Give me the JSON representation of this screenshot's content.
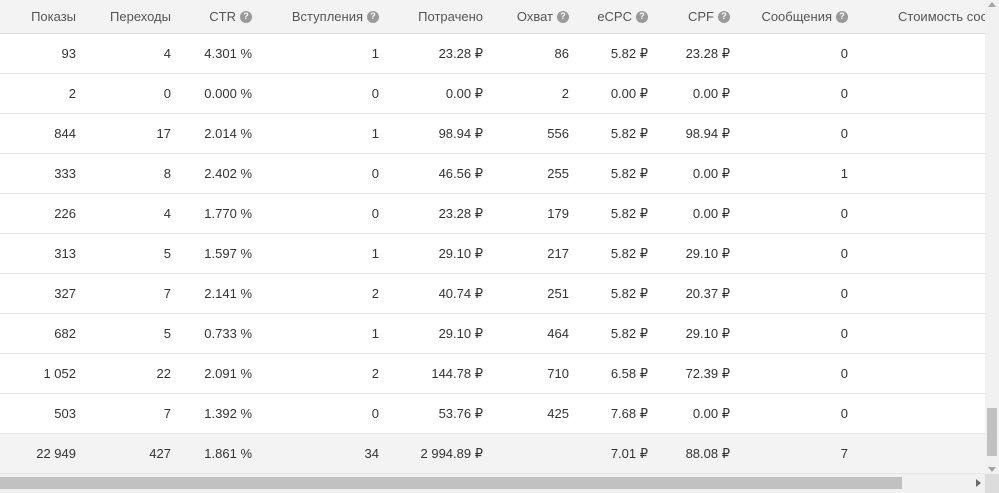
{
  "columns": [
    {
      "key": "impressions",
      "label": "Показы",
      "help": false
    },
    {
      "key": "clicks",
      "label": "Переходы",
      "help": false
    },
    {
      "key": "ctr",
      "label": "CTR",
      "help": true
    },
    {
      "key": "joins",
      "label": "Вступления",
      "help": true
    },
    {
      "key": "spent",
      "label": "Потрачено",
      "help": false
    },
    {
      "key": "reach",
      "label": "Охват",
      "help": true
    },
    {
      "key": "ecpc",
      "label": "eCPC",
      "help": true
    },
    {
      "key": "cpf",
      "label": "CPF",
      "help": true
    },
    {
      "key": "messages",
      "label": "Сообщения",
      "help": true
    },
    {
      "key": "message_cost",
      "label": "Стоимость соо",
      "help": false
    }
  ],
  "help_glyph": "?",
  "rows": [
    {
      "impressions": "93",
      "clicks": "4",
      "ctr": "4.301 %",
      "joins": "1",
      "spent": "23.28 ₽",
      "reach": "86",
      "ecpc": "5.82 ₽",
      "cpf": "23.28 ₽",
      "messages": "0",
      "message_cost": ""
    },
    {
      "impressions": "2",
      "clicks": "0",
      "ctr": "0.000 %",
      "joins": "0",
      "spent": "0.00 ₽",
      "reach": "2",
      "ecpc": "0.00 ₽",
      "cpf": "0.00 ₽",
      "messages": "0",
      "message_cost": ""
    },
    {
      "impressions": "844",
      "clicks": "17",
      "ctr": "2.014 %",
      "joins": "1",
      "spent": "98.94 ₽",
      "reach": "556",
      "ecpc": "5.82 ₽",
      "cpf": "98.94 ₽",
      "messages": "0",
      "message_cost": ""
    },
    {
      "impressions": "333",
      "clicks": "8",
      "ctr": "2.402 %",
      "joins": "0",
      "spent": "46.56 ₽",
      "reach": "255",
      "ecpc": "5.82 ₽",
      "cpf": "0.00 ₽",
      "messages": "1",
      "message_cost": ""
    },
    {
      "impressions": "226",
      "clicks": "4",
      "ctr": "1.770 %",
      "joins": "0",
      "spent": "23.28 ₽",
      "reach": "179",
      "ecpc": "5.82 ₽",
      "cpf": "0.00 ₽",
      "messages": "0",
      "message_cost": ""
    },
    {
      "impressions": "313",
      "clicks": "5",
      "ctr": "1.597 %",
      "joins": "1",
      "spent": "29.10 ₽",
      "reach": "217",
      "ecpc": "5.82 ₽",
      "cpf": "29.10 ₽",
      "messages": "0",
      "message_cost": ""
    },
    {
      "impressions": "327",
      "clicks": "7",
      "ctr": "2.141 %",
      "joins": "2",
      "spent": "40.74 ₽",
      "reach": "251",
      "ecpc": "5.82 ₽",
      "cpf": "20.37 ₽",
      "messages": "0",
      "message_cost": ""
    },
    {
      "impressions": "682",
      "clicks": "5",
      "ctr": "0.733 %",
      "joins": "1",
      "spent": "29.10 ₽",
      "reach": "464",
      "ecpc": "5.82 ₽",
      "cpf": "29.10 ₽",
      "messages": "0",
      "message_cost": ""
    },
    {
      "impressions": "1 052",
      "clicks": "22",
      "ctr": "2.091 %",
      "joins": "2",
      "spent": "144.78 ₽",
      "reach": "710",
      "ecpc": "6.58 ₽",
      "cpf": "72.39 ₽",
      "messages": "0",
      "message_cost": ""
    },
    {
      "impressions": "503",
      "clicks": "7",
      "ctr": "1.392 %",
      "joins": "0",
      "spent": "53.76 ₽",
      "reach": "425",
      "ecpc": "7.68 ₽",
      "cpf": "0.00 ₽",
      "messages": "0",
      "message_cost": ""
    }
  ],
  "totals": {
    "impressions": "22 949",
    "clicks": "427",
    "ctr": "1.861 %",
    "joins": "34",
    "spent": "2 994.89 ₽",
    "reach": "",
    "ecpc": "7.01 ₽",
    "cpf": "88.08 ₽",
    "messages": "7",
    "message_cost": ""
  },
  "colors": {
    "header_bg": "#f3f3f3",
    "row_border": "#e6e6e6",
    "help_icon": "#9a9a9a",
    "text": "#333333"
  }
}
